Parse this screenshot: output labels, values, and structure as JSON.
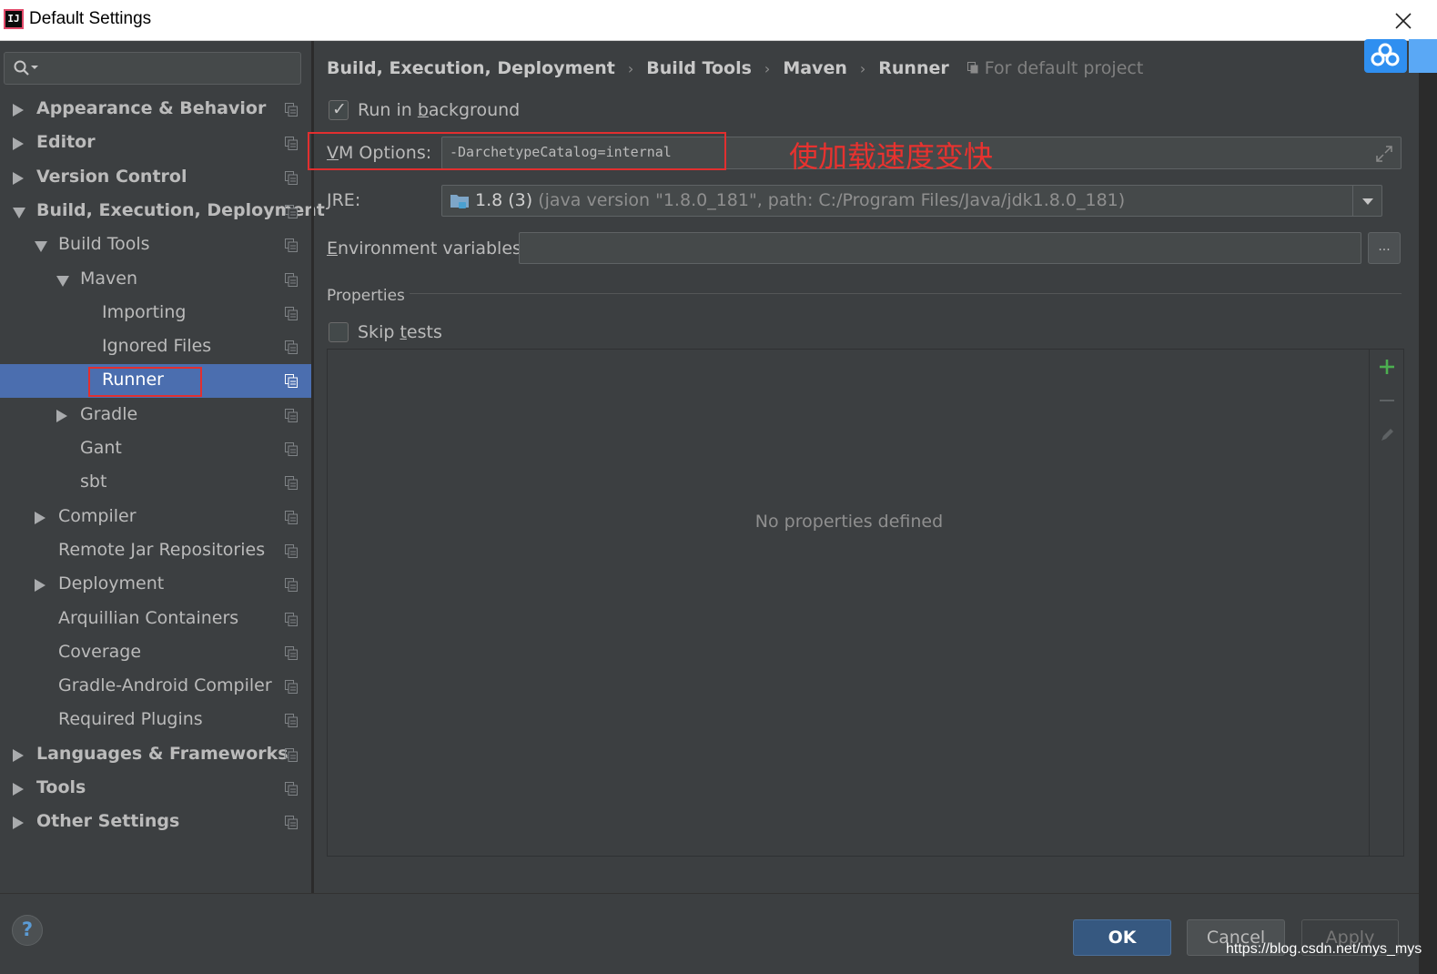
{
  "window": {
    "title": "Default Settings"
  },
  "search": {
    "placeholder": ""
  },
  "tree": {
    "items": [
      {
        "label": "Appearance & Behavior",
        "bold": true,
        "level": 0,
        "arrow": "right"
      },
      {
        "label": "Editor",
        "bold": true,
        "level": 0,
        "arrow": "right"
      },
      {
        "label": "Version Control",
        "bold": true,
        "level": 0,
        "arrow": "right"
      },
      {
        "label": "Build, Execution, Deployment",
        "bold": true,
        "level": 0,
        "arrow": "down"
      },
      {
        "label": "Build Tools",
        "bold": false,
        "level": 1,
        "arrow": "down"
      },
      {
        "label": "Maven",
        "bold": false,
        "level": 2,
        "arrow": "down"
      },
      {
        "label": "Importing",
        "bold": false,
        "level": 3,
        "arrow": "none"
      },
      {
        "label": "Ignored Files",
        "bold": false,
        "level": 3,
        "arrow": "none"
      },
      {
        "label": "Runner",
        "bold": false,
        "level": 3,
        "arrow": "none",
        "selected": true
      },
      {
        "label": "Gradle",
        "bold": false,
        "level": 2,
        "arrow": "right"
      },
      {
        "label": "Gant",
        "bold": false,
        "level": 2,
        "arrow": "none"
      },
      {
        "label": "sbt",
        "bold": false,
        "level": 2,
        "arrow": "none"
      },
      {
        "label": "Compiler",
        "bold": false,
        "level": 1,
        "arrow": "right"
      },
      {
        "label": "Remote Jar Repositories",
        "bold": false,
        "level": 1,
        "arrow": "none"
      },
      {
        "label": "Deployment",
        "bold": false,
        "level": 1,
        "arrow": "right"
      },
      {
        "label": "Arquillian Containers",
        "bold": false,
        "level": 1,
        "arrow": "none"
      },
      {
        "label": "Coverage",
        "bold": false,
        "level": 1,
        "arrow": "none"
      },
      {
        "label": "Gradle-Android Compiler",
        "bold": false,
        "level": 1,
        "arrow": "none"
      },
      {
        "label": "Required Plugins",
        "bold": false,
        "level": 1,
        "arrow": "none"
      },
      {
        "label": "Languages & Frameworks",
        "bold": true,
        "level": 0,
        "arrow": "right"
      },
      {
        "label": "Tools",
        "bold": true,
        "level": 0,
        "arrow": "right"
      },
      {
        "label": "Other Settings",
        "bold": true,
        "level": 0,
        "arrow": "right"
      }
    ]
  },
  "breadcrumb": {
    "items": [
      "Build, Execution, Deployment",
      "Build Tools",
      "Maven",
      "Runner"
    ],
    "separator": "›",
    "scope": "For default project"
  },
  "run_in_background": {
    "pre": "Run in ",
    "mnemonic": "b",
    "post": "ackground",
    "checked": true,
    "check_glyph": "✓"
  },
  "vm_options": {
    "mnemonic": "V",
    "rest": "M Options:",
    "value": "-DarchetypeCatalog=internal"
  },
  "annotation": {
    "text": "使加载速度变快",
    "color": "#e8322f"
  },
  "jre": {
    "mnemonic": "J",
    "rest": "RE:",
    "version": "1.8 (3)",
    "detail": "(java version \"1.8.0_181\", path: C:/Program Files/Java/jdk1.8.0_181)"
  },
  "env_vars": {
    "mnemonic": "E",
    "rest": "nvironment variables:",
    "value": "",
    "button_label": "..."
  },
  "properties": {
    "title": "Properties",
    "empty_text": "No properties defined"
  },
  "skip_tests": {
    "pre": "Skip ",
    "mnemonic": "t",
    "post": "ests",
    "checked": false
  },
  "buttons": {
    "ok": "OK",
    "cancel": "Cancel",
    "apply": "Apply",
    "help": "?"
  },
  "watermark": "https://blog.csdn.net/mys_mys",
  "colors": {
    "accent": "#4b6eaf",
    "highlight_box": "#e22f2f",
    "ok_button": "#365880",
    "add_icon": "#4caf50"
  }
}
